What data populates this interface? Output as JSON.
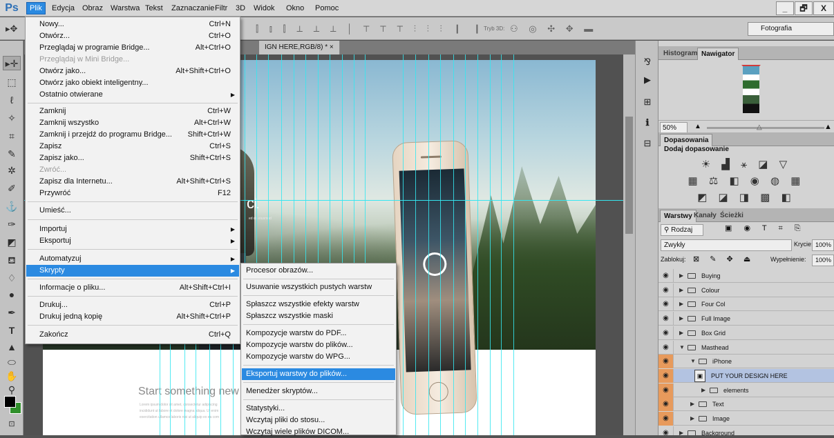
{
  "app": {
    "logo": "Ps"
  },
  "menubar": {
    "items": [
      "Plik",
      "Edycja",
      "Obraz",
      "Warstwa",
      "Tekst",
      "Zaznaczanie",
      "Filtr",
      "3D",
      "Widok",
      "Okno",
      "Pomoc"
    ],
    "window_buttons": [
      "_",
      "🗗",
      "X"
    ]
  },
  "options_bar": {
    "mode_3d_label": "Tryb 3D:",
    "workspace": "Fotografia"
  },
  "document": {
    "tab_title": "IGN HERE,RGB/8) * ×",
    "hero_text": "ct",
    "hero_small": "ed do eiusmod",
    "start_text": "Start something new",
    "lorem_lines": [
      "Lorem ipsum dolor sit amet, consectetur adipiscing",
      "incididunt ut labore et dolore magna aliqua. Ut enim",
      "exercitation ullamco laboris nisi ut aliquip ex ea com"
    ]
  },
  "file_menu": {
    "items": [
      {
        "label": "Nowy...",
        "shortcut": "Ctrl+N"
      },
      {
        "label": "Otwórz...",
        "shortcut": "Ctrl+O"
      },
      {
        "label": "Przeglądaj w programie Bridge...",
        "shortcut": "Alt+Ctrl+O"
      },
      {
        "label": "Przeglądaj w Mini Bridge...",
        "shortcut": "",
        "disabled": true
      },
      {
        "label": "Otwórz jako...",
        "shortcut": "Alt+Shift+Ctrl+O"
      },
      {
        "label": "Otwórz jako obiekt inteligentny...",
        "shortcut": ""
      },
      {
        "label": "Ostatnio otwierane",
        "shortcut": "",
        "submenu": true
      },
      {
        "label": "Zamknij",
        "shortcut": "Ctrl+W"
      },
      {
        "label": "Zamknij wszystko",
        "shortcut": "Alt+Ctrl+W"
      },
      {
        "label": "Zamknij i przejdź do programu Bridge...",
        "shortcut": "Shift+Ctrl+W"
      },
      {
        "label": "Zapisz",
        "shortcut": "Ctrl+S"
      },
      {
        "label": "Zapisz jako...",
        "shortcut": "Shift+Ctrl+S"
      },
      {
        "label": "Zwróć...",
        "shortcut": "",
        "disabled": true
      },
      {
        "label": "Zapisz dla Internetu...",
        "shortcut": "Alt+Shift+Ctrl+S"
      },
      {
        "label": "Przywróć",
        "shortcut": "F12"
      },
      {
        "label": "Umieść...",
        "shortcut": ""
      },
      {
        "label": "Importuj",
        "shortcut": "",
        "submenu": true
      },
      {
        "label": "Eksportuj",
        "shortcut": "",
        "submenu": true
      },
      {
        "label": "Automatyzuj",
        "shortcut": "",
        "submenu": true
      },
      {
        "label": "Skrypty",
        "shortcut": "",
        "submenu": true,
        "highlighted": true
      },
      {
        "label": "Informacje o pliku...",
        "shortcut": "Alt+Shift+Ctrl+I"
      },
      {
        "label": "Drukuj...",
        "shortcut": "Ctrl+P"
      },
      {
        "label": "Drukuj jedną kopię",
        "shortcut": "Alt+Shift+Ctrl+P"
      },
      {
        "label": "Zakończ",
        "shortcut": "Ctrl+Q"
      }
    ]
  },
  "scripts_menu": {
    "items": [
      {
        "label": "Procesor obrazów..."
      },
      {
        "label": "Usuwanie wszystkich pustych warstw"
      },
      {
        "label": "Spłaszcz wszystkie efekty warstw"
      },
      {
        "label": "Spłaszcz wszystkie maski"
      },
      {
        "label": "Kompozycje warstw do PDF..."
      },
      {
        "label": "Kompozycje warstw do plików..."
      },
      {
        "label": "Kompozycje warstw do WPG..."
      },
      {
        "label": "Eksportuj warstwy do plików...",
        "highlighted": true
      },
      {
        "label": "Menedżer skryptów..."
      },
      {
        "label": "Statystyki..."
      },
      {
        "label": "Wczytaj pliki do stosu..."
      },
      {
        "label": "Wczytaj wiele plików DICOM..."
      }
    ]
  },
  "panels": {
    "nav_tabs": [
      "Histogram",
      "Nawigator"
    ],
    "zoom": "50%",
    "adjust_tab": "Dopasowania",
    "adjust_title": "Dodaj dopasowanie",
    "layer_tabs": [
      "Warstwy",
      "Kanały",
      "Ścieżki"
    ],
    "filter_kind": "Rodzaj",
    "blend_mode": "Zwykły",
    "opacity_label": "Krycie:",
    "opacity_value": "100%",
    "lock_label": "Zablokuj:",
    "fill_label": "Wypełnienie:",
    "fill_value": "100%"
  },
  "layers": [
    {
      "name": "Buying",
      "kind": "group",
      "depth": 0,
      "open": false
    },
    {
      "name": "Colour",
      "kind": "group",
      "depth": 0,
      "open": false
    },
    {
      "name": "Four Col",
      "kind": "group",
      "depth": 0,
      "open": false
    },
    {
      "name": "Full Image",
      "kind": "group",
      "depth": 0,
      "open": false
    },
    {
      "name": "Box Grid",
      "kind": "group",
      "depth": 0,
      "open": false
    },
    {
      "name": "Masthead",
      "kind": "group",
      "depth": 0,
      "open": true
    },
    {
      "name": "iPhone",
      "kind": "group",
      "depth": 1,
      "open": true,
      "orange": true
    },
    {
      "name": "PUT YOUR DESIGN HERE",
      "kind": "smart",
      "depth": 2,
      "orange": true,
      "selected": true
    },
    {
      "name": "elements",
      "kind": "group",
      "depth": 2,
      "open": false,
      "orange": true
    },
    {
      "name": "Text",
      "kind": "group",
      "depth": 1,
      "open": false,
      "orange": true
    },
    {
      "name": "Image",
      "kind": "group",
      "depth": 1,
      "open": false,
      "orange": true
    },
    {
      "name": "Background",
      "kind": "group",
      "depth": 0,
      "open": false
    }
  ]
}
